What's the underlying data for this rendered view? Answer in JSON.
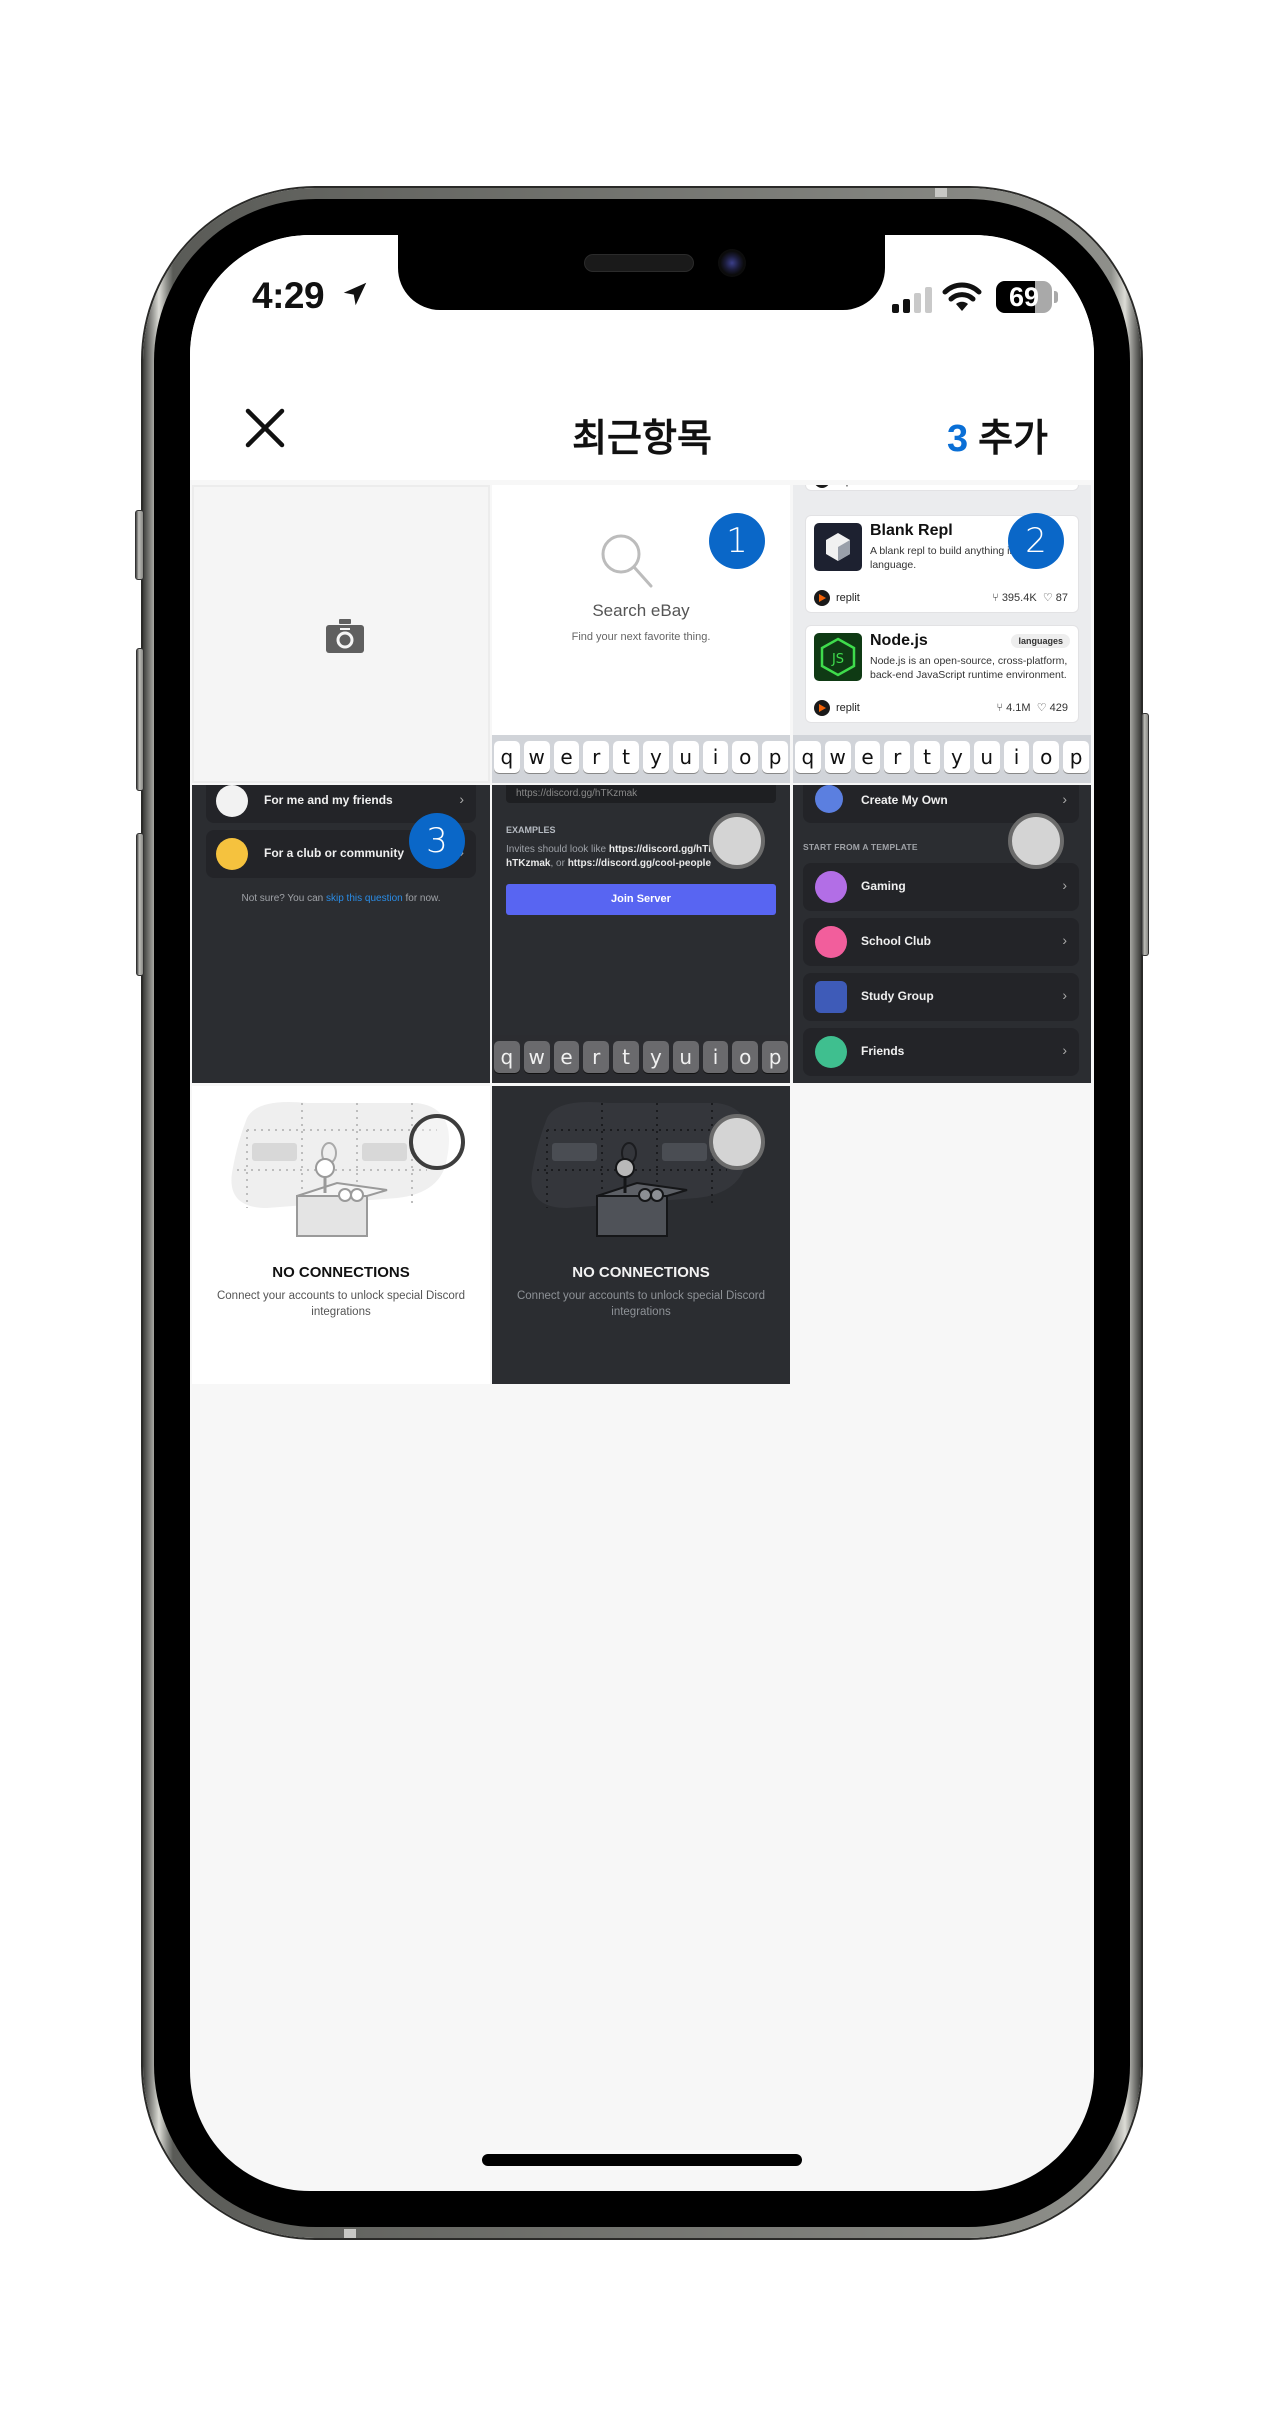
{
  "status_bar": {
    "time": "4:29",
    "location_icon": "location-arrow-icon",
    "signal_icon": "cellular-signal-icon",
    "wifi_icon": "wifi-icon",
    "battery_level": "69",
    "battery_fraction": 0.69
  },
  "header": {
    "close_icon": "close-icon",
    "title": "최근항목",
    "selected_count": "3",
    "add_label": "추가"
  },
  "colors": {
    "accent": "#0a67c8",
    "discord_blurple": "#5865f2",
    "discord_dark_bg": "#2b2d31"
  },
  "grid": {
    "camera_cell": {
      "icon": "camera-icon"
    },
    "items": [
      {
        "id": "ebay",
        "selection": "1",
        "selected": true,
        "search_title": "Search eBay",
        "search_subtitle": "Find your next favorite thing."
      },
      {
        "id": "replit",
        "selection": "2",
        "selected": true,
        "cards": [
          {
            "title": "Blank Repl",
            "description": "A blank repl to build anything in any language.",
            "tag": "",
            "author": "replit",
            "forks": "395.4K",
            "likes": "87"
          },
          {
            "title": "Node.js",
            "description": "Node.js is an open-source, cross-platform, back-end JavaScript runtime environment.",
            "tag": "languages",
            "author": "replit",
            "forks": "4.1M",
            "likes": "429"
          }
        ],
        "partial_top_author": "replit"
      },
      {
        "id": "discord-purpose",
        "selection": "3",
        "selected": true,
        "options": [
          {
            "label": "For me and my friends"
          },
          {
            "label": "For a club or community"
          }
        ],
        "note_prefix": "Not sure? You can ",
        "note_link": "skip this question",
        "note_suffix": " for now."
      },
      {
        "id": "discord-join",
        "selection": "",
        "selected": false,
        "input_value": "https://discord.gg/hTKzmak",
        "examples_heading": "EXAMPLES",
        "examples_prefix": "Invites should look like ",
        "example_1": "https://discord.gg/hTKzmak",
        "examples_sep_1": ", ",
        "example_2": "hTKzmak",
        "examples_sep_2": ", or ",
        "example_3": "https://discord.gg/cool-people",
        "join_button": "Join Server"
      },
      {
        "id": "discord-templates",
        "selection": "",
        "selected": false,
        "create_own": "Create My Own",
        "section_heading": "START FROM A TEMPLATE",
        "templates": [
          {
            "label": "Gaming"
          },
          {
            "label": "School Club"
          },
          {
            "label": "Study Group"
          },
          {
            "label": "Friends"
          }
        ]
      },
      {
        "id": "no-connections-light",
        "selection": "",
        "selected": false,
        "title": "NO CONNECTIONS",
        "subtitle": "Connect your accounts to unlock special Discord integrations"
      },
      {
        "id": "no-connections-dark",
        "selection": "",
        "selected": false,
        "title": "NO CONNECTIONS",
        "subtitle": "Connect your accounts to unlock special Discord integrations"
      }
    ]
  },
  "keyboard": {
    "row": [
      "q",
      "w",
      "e",
      "r",
      "t",
      "y",
      "u",
      "i",
      "o",
      "p"
    ]
  }
}
